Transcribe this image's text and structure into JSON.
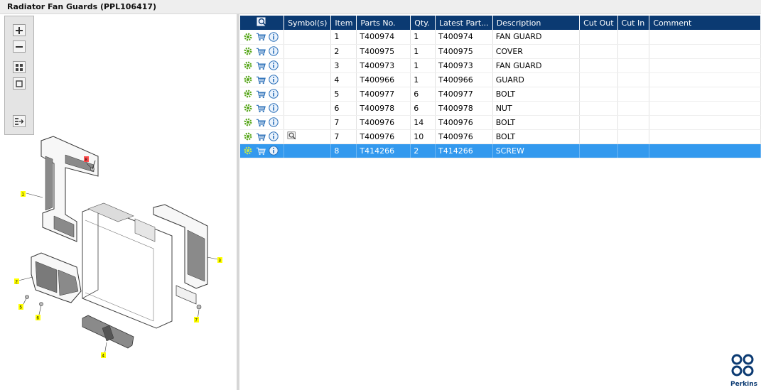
{
  "window": {
    "title": "Radiator Fan Guards (PPL106417)"
  },
  "toolbar": {
    "buttons": [
      "zoom-in",
      "zoom-out",
      "fit-all",
      "actual-size",
      "export"
    ]
  },
  "diagram": {
    "callouts": [
      "1",
      "2",
      "3",
      "4",
      "5",
      "6",
      "7",
      "8"
    ]
  },
  "grid": {
    "columns": [
      "",
      "Symbol(s)",
      "Item",
      "Parts No.",
      "Qty.",
      "Latest Part...",
      "Description",
      "Cut Out",
      "Cut In",
      "Comment"
    ],
    "rows": [
      {
        "symbol": false,
        "item": "1",
        "part_no": "T400974",
        "qty": "1",
        "latest_part": "T400974",
        "description": "FAN GUARD",
        "cut_out": "",
        "cut_in": "",
        "comment": "",
        "selected": false
      },
      {
        "symbol": false,
        "item": "2",
        "part_no": "T400975",
        "qty": "1",
        "latest_part": "T400975",
        "description": "COVER",
        "cut_out": "",
        "cut_in": "",
        "comment": "",
        "selected": false
      },
      {
        "symbol": false,
        "item": "3",
        "part_no": "T400973",
        "qty": "1",
        "latest_part": "T400973",
        "description": "FAN GUARD",
        "cut_out": "",
        "cut_in": "",
        "comment": "",
        "selected": false
      },
      {
        "symbol": false,
        "item": "4",
        "part_no": "T400966",
        "qty": "1",
        "latest_part": "T400966",
        "description": "GUARD",
        "cut_out": "",
        "cut_in": "",
        "comment": "",
        "selected": false
      },
      {
        "symbol": false,
        "item": "5",
        "part_no": "T400977",
        "qty": "6",
        "latest_part": "T400977",
        "description": "BOLT",
        "cut_out": "",
        "cut_in": "",
        "comment": "",
        "selected": false
      },
      {
        "symbol": false,
        "item": "6",
        "part_no": "T400978",
        "qty": "6",
        "latest_part": "T400978",
        "description": "NUT",
        "cut_out": "",
        "cut_in": "",
        "comment": "",
        "selected": false
      },
      {
        "symbol": false,
        "item": "7",
        "part_no": "T400976",
        "qty": "14",
        "latest_part": "T400976",
        "description": "BOLT",
        "cut_out": "",
        "cut_in": "",
        "comment": "",
        "selected": false
      },
      {
        "symbol": true,
        "item": "7",
        "part_no": "T400976",
        "qty": "10",
        "latest_part": "T400976",
        "description": "BOLT",
        "cut_out": "",
        "cut_in": "",
        "comment": "",
        "selected": false
      },
      {
        "symbol": false,
        "item": "8",
        "part_no": "T414266",
        "qty": "2",
        "latest_part": "T414266",
        "description": "SCREW",
        "cut_out": "",
        "cut_in": "",
        "comment": "",
        "selected": true
      }
    ]
  },
  "logo": {
    "text": "Perkins"
  },
  "colors": {
    "header_bg": "#0b3a72",
    "selected_row": "#3399ee",
    "callout_yellow": "#ffff00",
    "callout_red": "#ff4d4d"
  }
}
